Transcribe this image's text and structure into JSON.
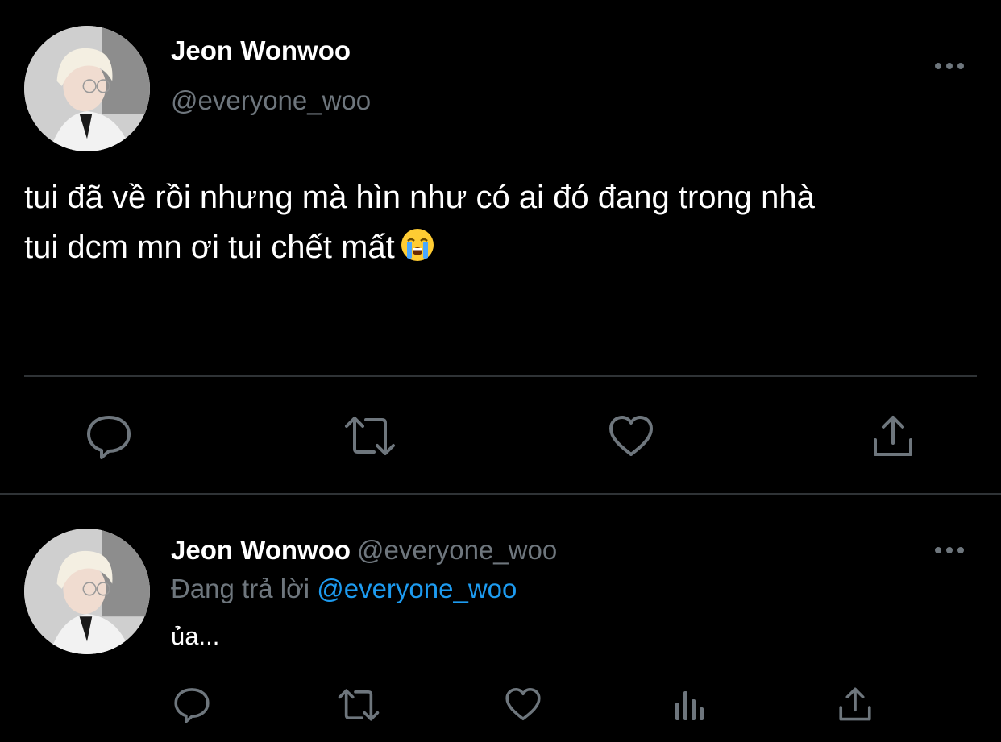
{
  "main_tweet": {
    "author_name": "Jeon Wonwoo",
    "author_handle": "@everyone_woo",
    "text_line1": "tui đã về rồi nhưng mà hìn như có ai đó đang trong nhà",
    "text_line2": "tui dcm mn ơi tui chết mất",
    "emoji": "loudly-crying-face",
    "actions": [
      "reply-icon",
      "retweet-icon",
      "like-icon",
      "share-icon"
    ]
  },
  "reply_tweet": {
    "author_name": "Jeon Wonwoo",
    "author_handle": "@everyone_woo",
    "replying_prefix": "Đang trả lời",
    "replying_to": "@everyone_woo",
    "text": "ủa...",
    "actions": [
      "reply-icon",
      "retweet-icon",
      "like-icon",
      "analytics-icon",
      "share-icon"
    ]
  },
  "colors": {
    "background": "#000000",
    "primary_text": "#ffffff",
    "secondary_text": "#6e767d",
    "link": "#1d9bf0",
    "divider": "#2f3336"
  }
}
